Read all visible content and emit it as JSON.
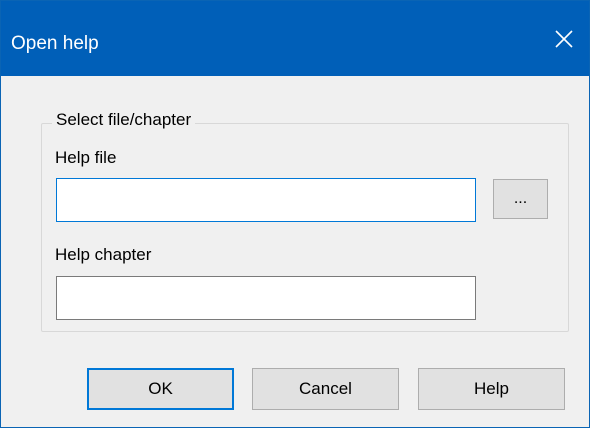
{
  "window": {
    "title": "Open help"
  },
  "group": {
    "legend": "Select file/chapter"
  },
  "help_file": {
    "label": "Help file",
    "value": "",
    "browse_label": "..."
  },
  "help_chapter": {
    "label": "Help chapter",
    "value": ""
  },
  "buttons": {
    "ok": "OK",
    "cancel": "Cancel",
    "help": "Help"
  },
  "colors": {
    "titlebar": "#005fb8",
    "focus_border": "#0078d7",
    "dialog_bg": "#f0f0f0"
  },
  "icons": {
    "close": "close-icon"
  }
}
